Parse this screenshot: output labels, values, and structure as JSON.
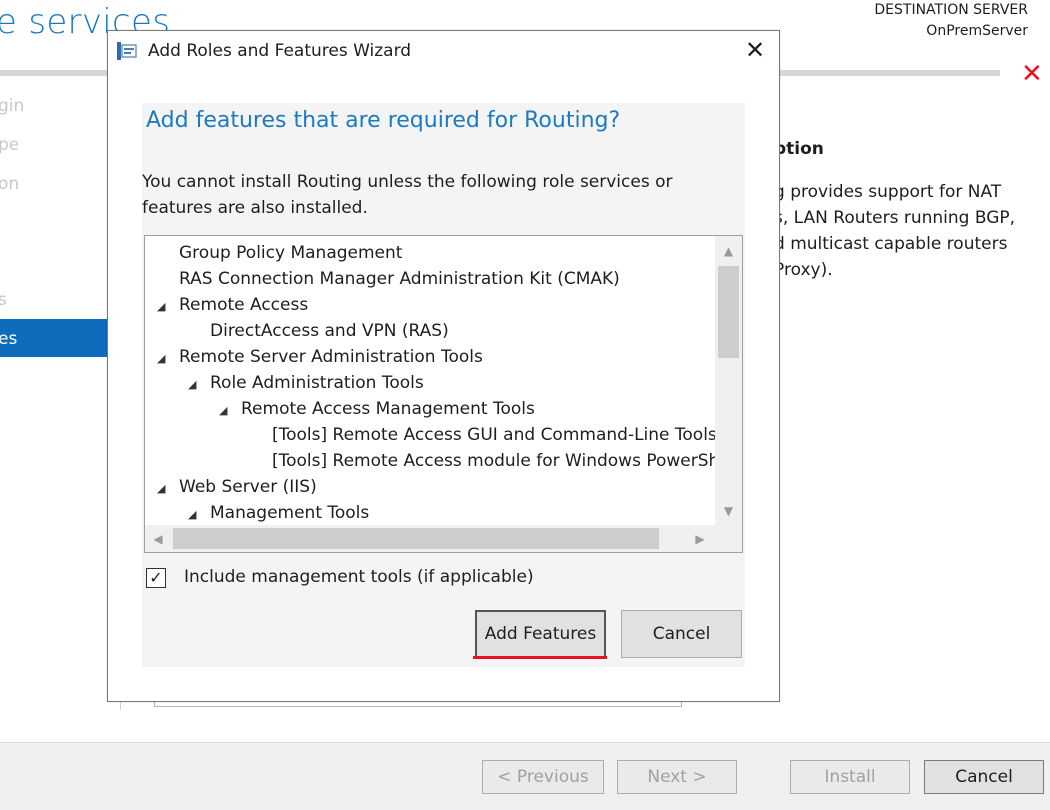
{
  "background_wizard": {
    "title": "e services",
    "destination_label": "DESTINATION SERVER",
    "destination_server": "OnPremServer",
    "nav_items": [
      "gin",
      "pe",
      "on",
      "s"
    ],
    "nav_selected": "es",
    "description_heading": "ption",
    "description_text": "g provides support for NAT\ns, LAN Routers running BGP,\nd multicast capable routers\nProxy).",
    "footer_buttons": {
      "previous": "< Previous",
      "next": "Next >",
      "install": "Install",
      "cancel": "Cancel"
    }
  },
  "dialog": {
    "title": "Add Roles and Features Wizard",
    "close_glyph": "✕",
    "heading": "Add features that are required for Routing?",
    "message": "You cannot install Routing unless the following role services or\nfeatures are also installed.",
    "tree": [
      {
        "label": "Group Policy Management",
        "level": 0,
        "expandable": false
      },
      {
        "label": "RAS Connection Manager Administration Kit (CMAK)",
        "level": 0,
        "expandable": false
      },
      {
        "label": "Remote Access",
        "level": 0,
        "expandable": true
      },
      {
        "label": "DirectAccess and VPN (RAS)",
        "level": 1,
        "expandable": false
      },
      {
        "label": "Remote Server Administration Tools",
        "level": 0,
        "expandable": true
      },
      {
        "label": "Role Administration Tools",
        "level": 1,
        "expandable": true
      },
      {
        "label": "Remote Access Management Tools",
        "level": 2,
        "expandable": true
      },
      {
        "label": "[Tools] Remote Access GUI and Command-Line Tools",
        "level": 3,
        "expandable": false
      },
      {
        "label": "[Tools] Remote Access module for Windows PowerShell",
        "level": 3,
        "expandable": false
      },
      {
        "label": "Web Server (IIS)",
        "level": 0,
        "expandable": true
      },
      {
        "label": "Management Tools",
        "level": 1,
        "expandable": true
      }
    ],
    "include_tools_checked": true,
    "include_tools_label": "Include management tools (if applicable)",
    "add_features_label": "Add Features",
    "cancel_label": "Cancel"
  },
  "colors": {
    "accent_blue": "#1c7ac0",
    "selected_nav": "#0f6cbd",
    "close_red": "#e81123",
    "highlight_underline": "#e81123"
  }
}
